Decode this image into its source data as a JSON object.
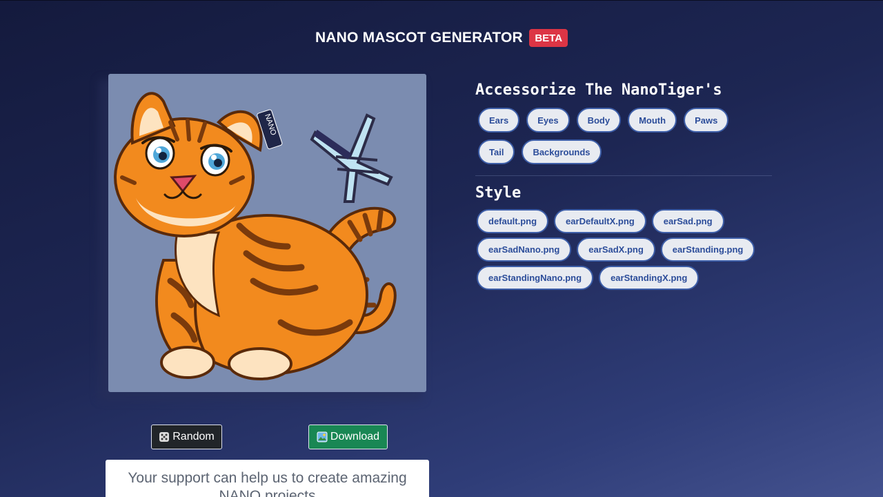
{
  "header": {
    "title": "NANO MASCOT GENERATOR",
    "badge": "BETA"
  },
  "preview": {
    "tag_text": "NANO",
    "background_color": "#7b8cb0"
  },
  "actions": {
    "random_label": "Random",
    "download_label": "Download",
    "random_icon": "dice-icon",
    "download_icon": "picture-icon"
  },
  "support": {
    "text": "Your support can help us to create amazing NANO projects"
  },
  "accessorize": {
    "title": "Accessorize The NanoTiger's",
    "tabs": [
      "Ears",
      "Eyes",
      "Body",
      "Mouth",
      "Paws",
      "Tail",
      "Backgrounds"
    ]
  },
  "style": {
    "title": "Style",
    "options": [
      "default.png",
      "earDefaultX.png",
      "earSad.png",
      "earSadNano.png",
      "earSadX.png",
      "earStanding.png",
      "earStandingNano.png",
      "earStandingX.png"
    ]
  },
  "colors": {
    "beta_badge": "#dc3545",
    "random_button": "#212529",
    "download_button": "#198754",
    "chip_border": "#3d5ea8",
    "chip_text": "#2c4d9a"
  }
}
